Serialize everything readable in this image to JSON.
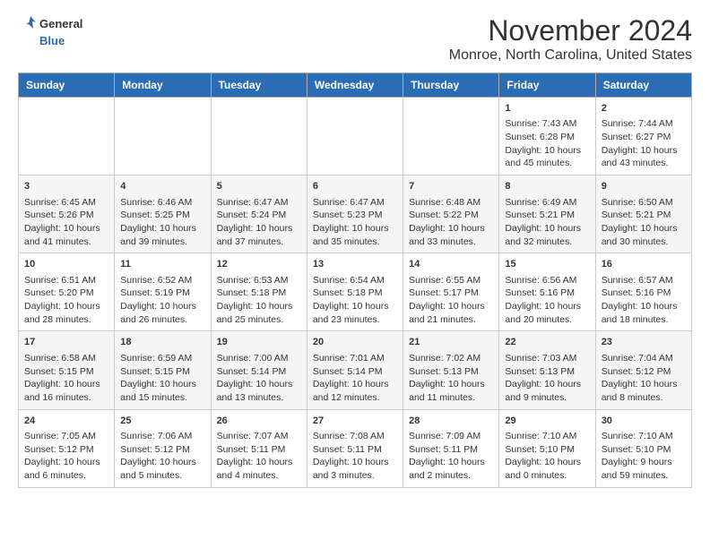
{
  "header": {
    "logo_line1": "General",
    "logo_line2": "Blue",
    "month_title": "November 2024",
    "location": "Monroe, North Carolina, United States"
  },
  "weekdays": [
    "Sunday",
    "Monday",
    "Tuesday",
    "Wednesday",
    "Thursday",
    "Friday",
    "Saturday"
  ],
  "weeks": [
    [
      {
        "day": "",
        "info": ""
      },
      {
        "day": "",
        "info": ""
      },
      {
        "day": "",
        "info": ""
      },
      {
        "day": "",
        "info": ""
      },
      {
        "day": "",
        "info": ""
      },
      {
        "day": "1",
        "info": "Sunrise: 7:43 AM\nSunset: 6:28 PM\nDaylight: 10 hours and 45 minutes."
      },
      {
        "day": "2",
        "info": "Sunrise: 7:44 AM\nSunset: 6:27 PM\nDaylight: 10 hours and 43 minutes."
      }
    ],
    [
      {
        "day": "3",
        "info": "Sunrise: 6:45 AM\nSunset: 5:26 PM\nDaylight: 10 hours and 41 minutes."
      },
      {
        "day": "4",
        "info": "Sunrise: 6:46 AM\nSunset: 5:25 PM\nDaylight: 10 hours and 39 minutes."
      },
      {
        "day": "5",
        "info": "Sunrise: 6:47 AM\nSunset: 5:24 PM\nDaylight: 10 hours and 37 minutes."
      },
      {
        "day": "6",
        "info": "Sunrise: 6:47 AM\nSunset: 5:23 PM\nDaylight: 10 hours and 35 minutes."
      },
      {
        "day": "7",
        "info": "Sunrise: 6:48 AM\nSunset: 5:22 PM\nDaylight: 10 hours and 33 minutes."
      },
      {
        "day": "8",
        "info": "Sunrise: 6:49 AM\nSunset: 5:21 PM\nDaylight: 10 hours and 32 minutes."
      },
      {
        "day": "9",
        "info": "Sunrise: 6:50 AM\nSunset: 5:21 PM\nDaylight: 10 hours and 30 minutes."
      }
    ],
    [
      {
        "day": "10",
        "info": "Sunrise: 6:51 AM\nSunset: 5:20 PM\nDaylight: 10 hours and 28 minutes."
      },
      {
        "day": "11",
        "info": "Sunrise: 6:52 AM\nSunset: 5:19 PM\nDaylight: 10 hours and 26 minutes."
      },
      {
        "day": "12",
        "info": "Sunrise: 6:53 AM\nSunset: 5:18 PM\nDaylight: 10 hours and 25 minutes."
      },
      {
        "day": "13",
        "info": "Sunrise: 6:54 AM\nSunset: 5:18 PM\nDaylight: 10 hours and 23 minutes."
      },
      {
        "day": "14",
        "info": "Sunrise: 6:55 AM\nSunset: 5:17 PM\nDaylight: 10 hours and 21 minutes."
      },
      {
        "day": "15",
        "info": "Sunrise: 6:56 AM\nSunset: 5:16 PM\nDaylight: 10 hours and 20 minutes."
      },
      {
        "day": "16",
        "info": "Sunrise: 6:57 AM\nSunset: 5:16 PM\nDaylight: 10 hours and 18 minutes."
      }
    ],
    [
      {
        "day": "17",
        "info": "Sunrise: 6:58 AM\nSunset: 5:15 PM\nDaylight: 10 hours and 16 minutes."
      },
      {
        "day": "18",
        "info": "Sunrise: 6:59 AM\nSunset: 5:15 PM\nDaylight: 10 hours and 15 minutes."
      },
      {
        "day": "19",
        "info": "Sunrise: 7:00 AM\nSunset: 5:14 PM\nDaylight: 10 hours and 13 minutes."
      },
      {
        "day": "20",
        "info": "Sunrise: 7:01 AM\nSunset: 5:14 PM\nDaylight: 10 hours and 12 minutes."
      },
      {
        "day": "21",
        "info": "Sunrise: 7:02 AM\nSunset: 5:13 PM\nDaylight: 10 hours and 11 minutes."
      },
      {
        "day": "22",
        "info": "Sunrise: 7:03 AM\nSunset: 5:13 PM\nDaylight: 10 hours and 9 minutes."
      },
      {
        "day": "23",
        "info": "Sunrise: 7:04 AM\nSunset: 5:12 PM\nDaylight: 10 hours and 8 minutes."
      }
    ],
    [
      {
        "day": "24",
        "info": "Sunrise: 7:05 AM\nSunset: 5:12 PM\nDaylight: 10 hours and 6 minutes."
      },
      {
        "day": "25",
        "info": "Sunrise: 7:06 AM\nSunset: 5:12 PM\nDaylight: 10 hours and 5 minutes."
      },
      {
        "day": "26",
        "info": "Sunrise: 7:07 AM\nSunset: 5:11 PM\nDaylight: 10 hours and 4 minutes."
      },
      {
        "day": "27",
        "info": "Sunrise: 7:08 AM\nSunset: 5:11 PM\nDaylight: 10 hours and 3 minutes."
      },
      {
        "day": "28",
        "info": "Sunrise: 7:09 AM\nSunset: 5:11 PM\nDaylight: 10 hours and 2 minutes."
      },
      {
        "day": "29",
        "info": "Sunrise: 7:10 AM\nSunset: 5:10 PM\nDaylight: 10 hours and 0 minutes."
      },
      {
        "day": "30",
        "info": "Sunrise: 7:10 AM\nSunset: 5:10 PM\nDaylight: 9 hours and 59 minutes."
      }
    ]
  ]
}
